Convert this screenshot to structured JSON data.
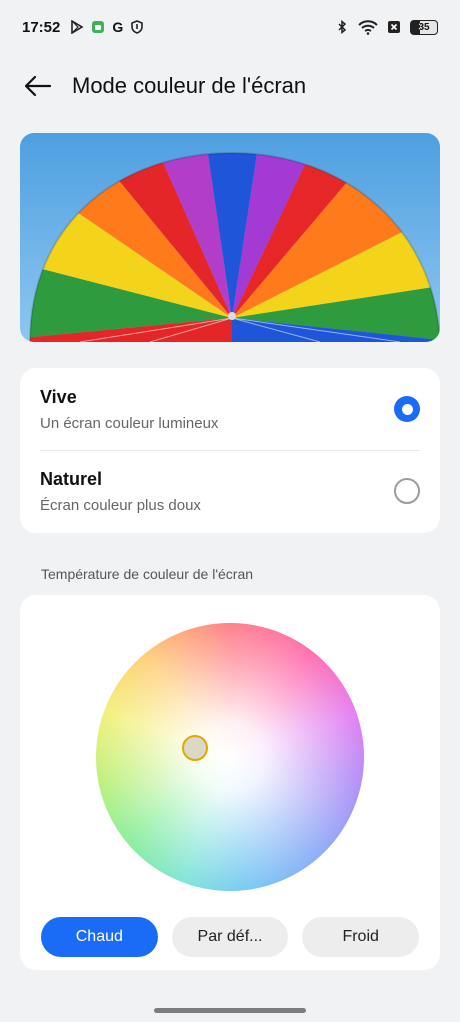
{
  "status_bar": {
    "time": "17:52",
    "g_letter": "G",
    "battery_level": "35",
    "icons_left": [
      "play-store-icon",
      "android-icon",
      "g-icon",
      "shield-icon"
    ],
    "icons_right": [
      "bluetooth-icon",
      "wifi-icon",
      "no-sim-icon",
      "battery-icon"
    ]
  },
  "header": {
    "title": "Mode couleur de l'écran",
    "back_icon": "arrow-left-icon"
  },
  "modes": [
    {
      "label": "Vive",
      "description": "Un écran couleur lumineux",
      "selected": true
    },
    {
      "label": "Naturel",
      "description": "Écran couleur plus doux",
      "selected": false
    }
  ],
  "temperature": {
    "section_label": "Température de couleur de l'écran",
    "buttons": [
      {
        "label": "Chaud",
        "active": true
      },
      {
        "label": "Par déf...",
        "active": false
      },
      {
        "label": "Froid",
        "active": false
      }
    ]
  },
  "colors": {
    "accent": "#1a6cf6",
    "background": "#f1f2f4",
    "card": "#ffffff"
  }
}
